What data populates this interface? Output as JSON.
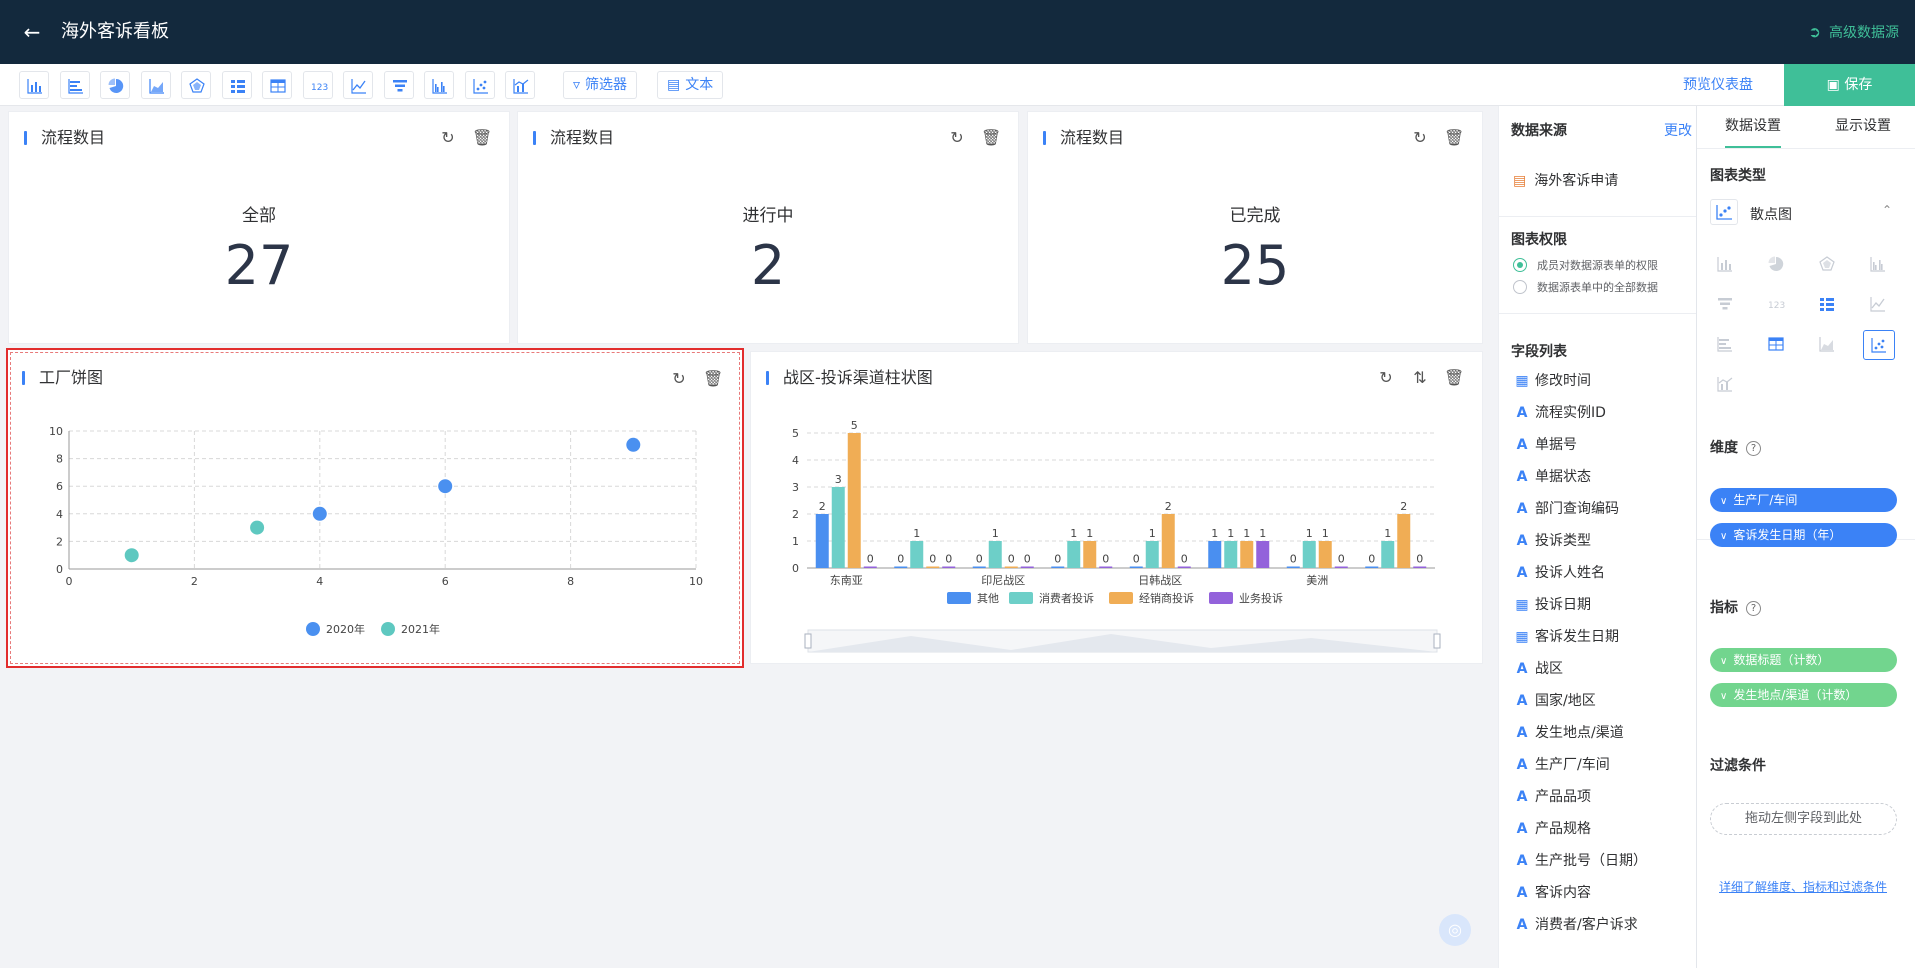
{
  "header": {
    "title": "海外客诉看板",
    "advanced_source": "高级数据源"
  },
  "toolbar": {
    "icons": [
      "bar-chart-icon",
      "horizontal-bar-icon",
      "pie-chart-icon",
      "area-chart-icon",
      "radar-chart-icon",
      "detail-list-icon",
      "table-icon",
      "number-card-icon",
      "line-chart-icon",
      "funnel-icon",
      "grouped-bar-icon",
      "scatter-icon",
      "combo-chart-icon"
    ],
    "filter_label": "筛选器",
    "text_label": "文本",
    "preview_label": "预览仪表盘",
    "save_label": "保存"
  },
  "cards": {
    "metric1": {
      "title": "流程数目",
      "label": "全部",
      "value": "27"
    },
    "metric2": {
      "title": "流程数目",
      "label": "进行中",
      "value": "2"
    },
    "metric3": {
      "title": "流程数目",
      "label": "已完成",
      "value": "25"
    },
    "scatter": {
      "title": "工厂饼图"
    },
    "bar": {
      "title": "战区-投诉渠道柱状图"
    }
  },
  "chart_data": [
    {
      "type": "scatter",
      "xlim": [
        0,
        10
      ],
      "ylim": [
        0,
        10
      ],
      "x_ticks": [
        "0",
        "2",
        "4",
        "6",
        "8",
        "10"
      ],
      "y_ticks": [
        "0",
        "2",
        "4",
        "6",
        "8",
        "10"
      ],
      "grid": true,
      "legend_position": "bottom-center",
      "series": [
        {
          "name": "2020年",
          "color": "#4a90f0",
          "points": [
            [
              4,
              4
            ],
            [
              6,
              6
            ],
            [
              9,
              9
            ]
          ]
        },
        {
          "name": "2021年",
          "color": "#5ec8c0",
          "points": [
            [
              1,
              1
            ],
            [
              3,
              3
            ]
          ]
        }
      ]
    },
    {
      "type": "bar",
      "categories": [
        "东南亚",
        "印尼战区",
        "日韩战区",
        "美洲"
      ],
      "ylim": [
        0,
        5
      ],
      "y_ticks": [
        "0",
        "1",
        "2",
        "3",
        "4",
        "5"
      ],
      "grid": true,
      "legend_position": "bottom-center",
      "groups": [
        {
          "label": "东南亚",
          "values": [
            2,
            3,
            5,
            0
          ]
        },
        {
          "label": "",
          "values": [
            0,
            1,
            0,
            0
          ]
        },
        {
          "label": "印尼战区",
          "values": [
            0,
            1,
            0,
            0
          ]
        },
        {
          "label": "",
          "values": [
            0,
            1,
            1,
            0
          ]
        },
        {
          "label": "日韩战区",
          "values": [
            0,
            1,
            2,
            0
          ]
        },
        {
          "label": "",
          "values": [
            1,
            1,
            1,
            1
          ]
        },
        {
          "label": "美洲",
          "values": [
            0,
            1,
            1,
            0
          ]
        },
        {
          "label": "",
          "values": [
            0,
            1,
            2,
            0
          ]
        }
      ],
      "series": [
        {
          "name": "其他",
          "color": "#4a8ff0"
        },
        {
          "name": "消费者投诉",
          "color": "#6dcfc8"
        },
        {
          "name": "经销商投诉",
          "color": "#f0ad55"
        },
        {
          "name": "业务投诉",
          "color": "#9362db"
        }
      ]
    }
  ],
  "datasource": {
    "title": "数据来源",
    "change": "更改",
    "name": "海外客诉申请",
    "perm_title": "图表权限",
    "perm_options": [
      "成员对数据源表单的权限",
      "数据源表单中的全部数据"
    ],
    "fields_title": "字段列表",
    "fields": [
      {
        "type": "date",
        "name": "修改时间"
      },
      {
        "type": "text",
        "name": "流程实例ID"
      },
      {
        "type": "text",
        "name": "单据号"
      },
      {
        "type": "text",
        "name": "单据状态"
      },
      {
        "type": "text",
        "name": "部门查询编码"
      },
      {
        "type": "text",
        "name": "投诉类型"
      },
      {
        "type": "text",
        "name": "投诉人姓名"
      },
      {
        "type": "date",
        "name": "投诉日期"
      },
      {
        "type": "date",
        "name": "客诉发生日期"
      },
      {
        "type": "text",
        "name": "战区"
      },
      {
        "type": "text",
        "name": "国家/地区"
      },
      {
        "type": "text",
        "name": "发生地点/渠道"
      },
      {
        "type": "text",
        "name": "生产厂/车间"
      },
      {
        "type": "text",
        "name": "产品品项"
      },
      {
        "type": "text",
        "name": "产品规格"
      },
      {
        "type": "text",
        "name": "生产批号（日期）"
      },
      {
        "type": "text",
        "name": "客诉内容"
      },
      {
        "type": "text",
        "name": "消费者/客户诉求"
      }
    ]
  },
  "settings": {
    "tab_data": "数据设置",
    "tab_display": "显示设置",
    "chart_type_title": "图表类型",
    "chart_type_value": "散点图",
    "chart_type_icons": [
      "bar-chart-icon",
      "pie-chart-icon",
      "radar-chart-icon",
      "grouped-bar-icon",
      "funnel-icon",
      "number-card-icon",
      "detail-list-icon",
      "line-chart-icon",
      "horizontal-bar-icon",
      "table-icon",
      "area-chart-icon",
      "scatter-icon",
      "combo-chart-icon"
    ],
    "dimension_title": "维度",
    "dimensions": [
      "生产厂/车间",
      "客诉发生日期（年）"
    ],
    "metric_title": "指标",
    "metrics": [
      "数据标题（计数）",
      "发生地点/渠道（计数）"
    ],
    "filter_title": "过滤条件",
    "filter_placeholder": "拖动左侧字段到此处",
    "learn_more": "详细了解维度、指标和过滤条件"
  }
}
